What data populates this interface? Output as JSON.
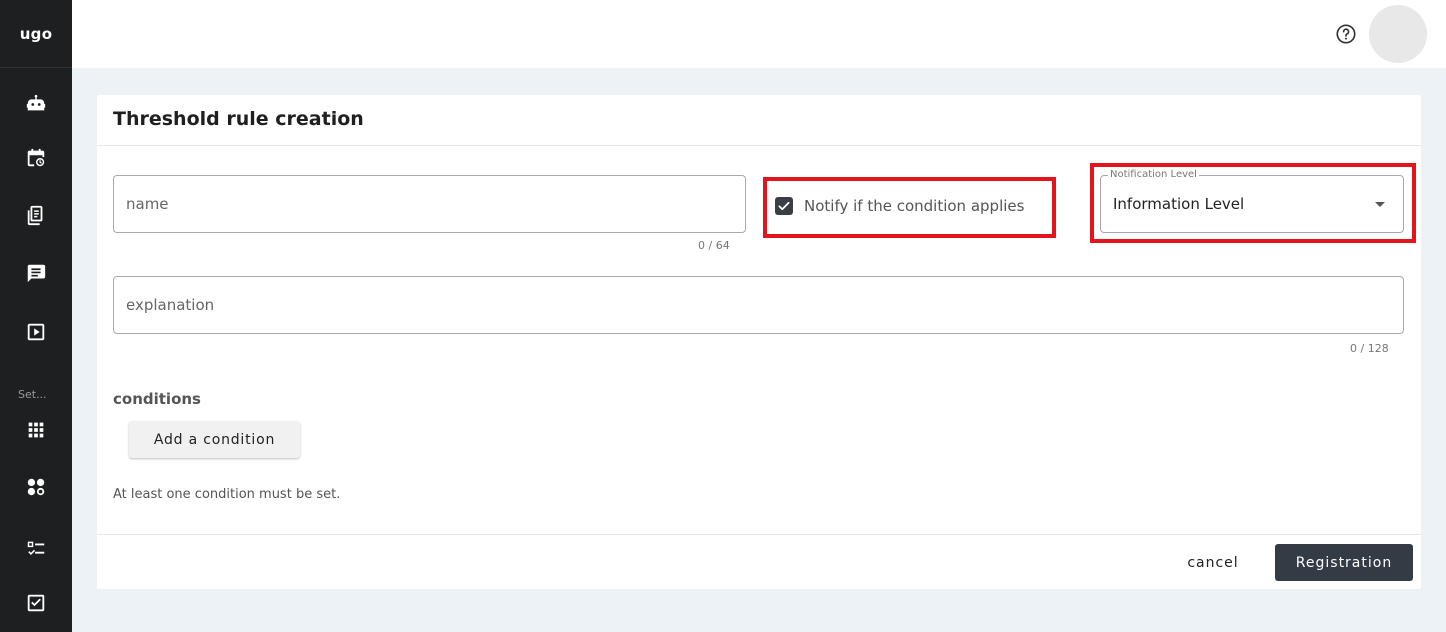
{
  "app": {
    "logo_text": "ugo"
  },
  "sidebar": {
    "section_label": "Set...",
    "items": [
      {
        "icon": "robot-icon"
      },
      {
        "icon": "calendar-clock-icon"
      },
      {
        "icon": "document-icon"
      },
      {
        "icon": "message-icon"
      },
      {
        "icon": "play-square-icon"
      },
      {
        "icon": "apps-grid-icon"
      },
      {
        "icon": "nodes-icon"
      },
      {
        "icon": "checklist-icon"
      },
      {
        "icon": "checkbox-icon"
      }
    ]
  },
  "header": {
    "help_icon": "help-circle-icon"
  },
  "form": {
    "title": "Threshold rule creation",
    "name_field": {
      "placeholder": "name",
      "value": "",
      "counter": "0 / 64"
    },
    "notify_checkbox": {
      "label": "Notify if the condition applies",
      "checked": true
    },
    "notification_level": {
      "legend": "Notification Level",
      "value": "Information Level"
    },
    "explanation_field": {
      "placeholder": "explanation",
      "value": "",
      "counter": "0 / 128"
    },
    "conditions": {
      "title": "conditions",
      "add_label": "Add a condition",
      "hint": "At least one condition must be set."
    },
    "footer": {
      "cancel_label": "cancel",
      "submit_label": "Registration"
    }
  },
  "colors": {
    "sidebar_bg": "#1e1f20",
    "page_bg": "#edf2f7",
    "primary_button": "#333c45",
    "highlight": "#e3141b"
  }
}
